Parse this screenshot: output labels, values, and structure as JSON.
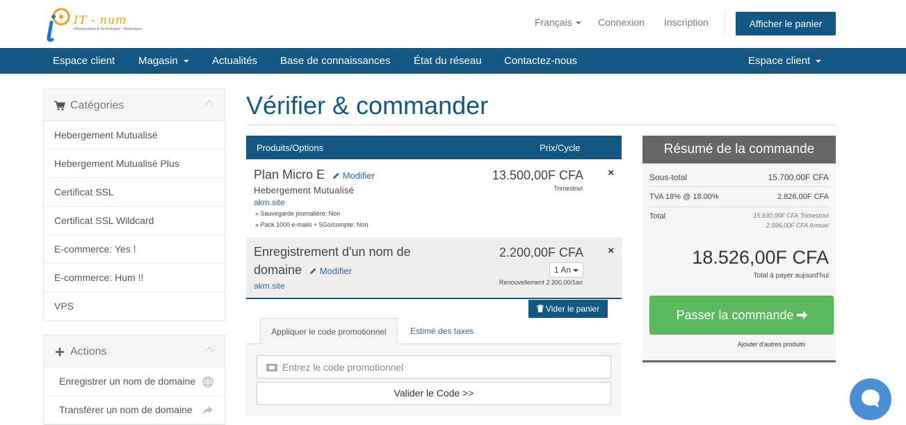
{
  "brand": {
    "name": "IT - num",
    "tagline": "Infrastructures & Technologies - Numériques",
    "colors": {
      "primary": "#135782",
      "accent": "#f39c12",
      "success": "#5cb85c"
    }
  },
  "topbar": {
    "language": "Français",
    "login": "Connexion",
    "register": "Inscription",
    "cart_button": "Afficher le panier"
  },
  "nav": {
    "items": [
      "Espace client",
      "Magasin",
      "Actualités",
      "Base de connaissances",
      "État du réseau",
      "Contactez-nous"
    ],
    "right": "Espace client"
  },
  "sidebar": {
    "categories_title": "Catégories",
    "categories": [
      "Hebergement Mutualisé",
      "Hebergement Mutualisé Plus",
      "Certificat SSL",
      "Certificat SSL Wildcard",
      "E-commerce: Yes !",
      "E-commerce: Hum !!",
      "VPS"
    ],
    "actions_title": "Actions",
    "actions": [
      {
        "label": "Enregistrer un nom de domaine",
        "icon": "globe-icon"
      },
      {
        "label": "Transférer un nom de domaine",
        "icon": "share-icon"
      }
    ]
  },
  "page": {
    "title": "Vérifier & commander"
  },
  "cart": {
    "col_product": "Produits/Options",
    "col_price": "Prix/Cycle",
    "items": [
      {
        "name": "Plan Micro E",
        "edit": "Modifier",
        "group": "Hebergement Mutualisé",
        "domain": "akm.site",
        "options": [
          "» Sauvegarde journalière: Non",
          "» Pack 1000 e-mails + 5Go/compte: Non"
        ],
        "price": "13.500,00F CFA",
        "cycle": "Trimestriel",
        "remove": "×"
      },
      {
        "name_line1": "Enregistrement d'un nom de",
        "name_line2": "domaine",
        "edit": "Modifier",
        "domain": "akm.site",
        "price": "2.200,00F CFA",
        "period": "1 An",
        "renewal": "Renouvellement 2.200,00/1an",
        "remove": "×"
      }
    ],
    "clear_button": "Vider le panier"
  },
  "promo": {
    "tab_active": "Appliquer le code promotionnel",
    "tab_other": "Estimé des taxes",
    "placeholder": "Entrez le code promotionnel",
    "validate_button": "Valider le Code >>"
  },
  "summary": {
    "title": "Résumé de la commande",
    "subtotal_label": "Sous-total",
    "subtotal_value": "15.700,00F CFA",
    "tax_label": "TVA 18% @ 18.00%",
    "tax_value": "2.826,00F CFA",
    "total_label": "Total",
    "total_line1": "15.930,00F CFA Trimestriel",
    "total_line2": "2.596,00F CFA Annuel",
    "due_today": "18.526,00F CFA",
    "due_today_label": "Total à payer aujourd'hui",
    "checkout_button": "Passer la commande",
    "continue_link": "Ajouter d'autres produits"
  }
}
